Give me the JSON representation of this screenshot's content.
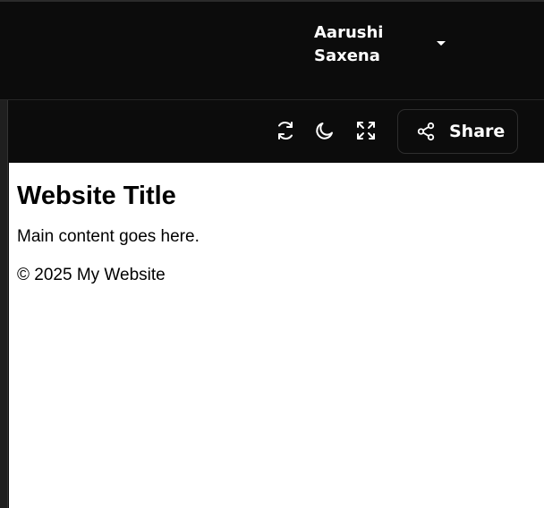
{
  "header": {
    "user": {
      "first_name": "Aarushi",
      "last_name": "Saxena"
    }
  },
  "toolbar": {
    "icons": [
      "refresh-icon",
      "moon-icon",
      "fullscreen-icon",
      "share-icon"
    ],
    "share_label": "Share"
  },
  "preview": {
    "title": "Website Title",
    "content": "Main content goes here.",
    "footer": "© 2025 My Website"
  },
  "colors": {
    "chrome_background": "#0c0c0c",
    "text_light": "#ffffff",
    "preview_background": "#ffffff",
    "border": "#2e2e2e"
  }
}
